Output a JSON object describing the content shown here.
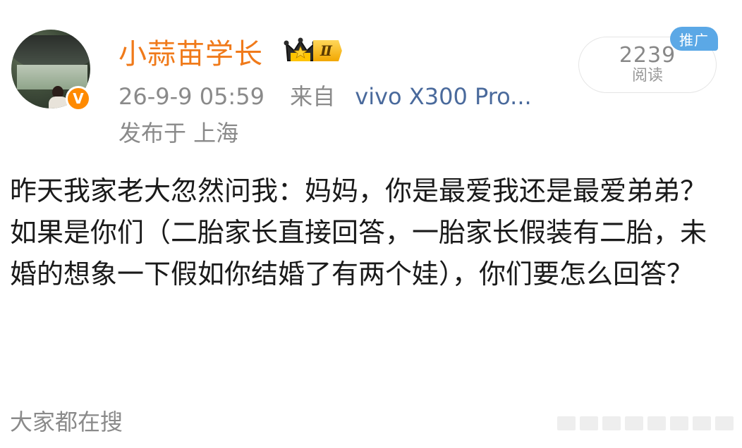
{
  "post": {
    "author": {
      "name": "小蒜苗学长",
      "level_label": "Ⅱ",
      "verified_mark": "V"
    },
    "timestamp": "26-9-9 05:59",
    "source_prefix": "来自",
    "device": "vivo X300 Pro...",
    "location": "发布于 上海",
    "reads": {
      "count": "2239",
      "label": "阅读"
    },
    "promo_tag": "推广",
    "body": {
      "line1": "昨天我家老大忽然问我：妈妈，你是最爱我还是最爱弟弟？",
      "line2": "如果是你们（二胎家长直接回答，一胎家长假装有二胎，未婚的想象一下假如你结婚了有两个娃），你们要怎么回答？"
    },
    "trending_label": "大家都在搜"
  },
  "colors": {
    "username": "#f07a1a",
    "verified": "#ff8a00",
    "device_link": "#4a6a9c",
    "promo": "#5ba8e6"
  },
  "icons": [
    "crown-icon",
    "verified-v-icon"
  ]
}
